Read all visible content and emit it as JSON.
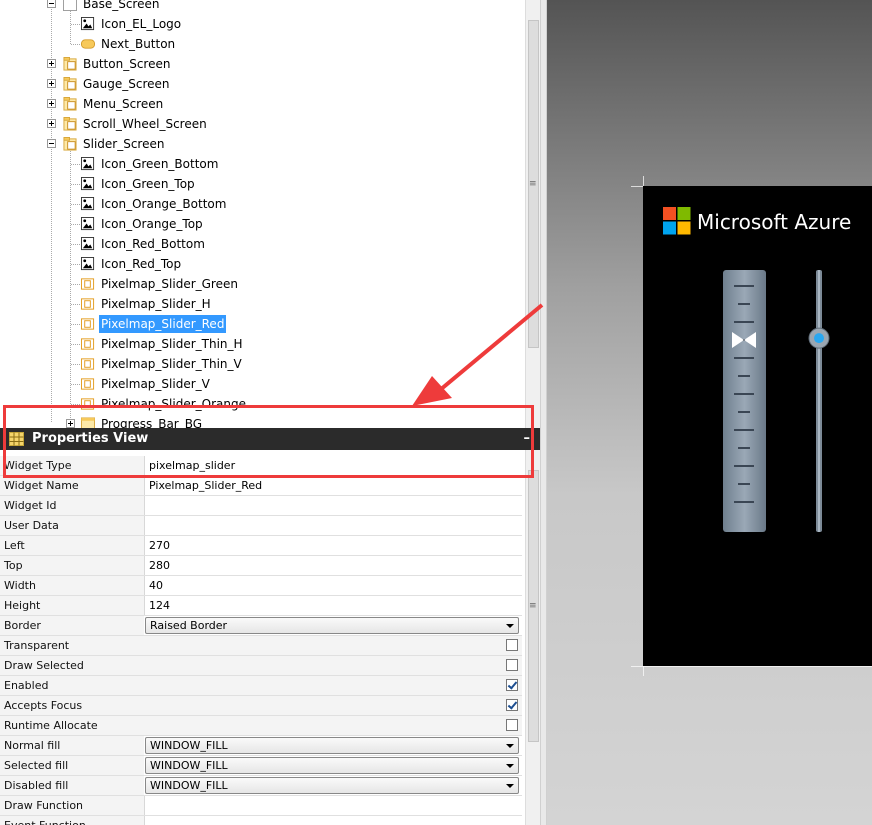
{
  "tree": {
    "items": [
      {
        "label": "Base_Screen",
        "icon": "screen-icon",
        "expander": "minus",
        "level": 0
      },
      {
        "label": "Icon_EL_Logo",
        "icon": "image-icon",
        "level": 1
      },
      {
        "label": "Next_Button",
        "icon": "button-icon",
        "level": 1
      },
      {
        "label": "Button_Screen",
        "icon": "folder-screen-icon",
        "expander": "plus",
        "level": 0
      },
      {
        "label": "Gauge_Screen",
        "icon": "folder-screen-icon",
        "expander": "plus",
        "level": 0
      },
      {
        "label": "Menu_Screen",
        "icon": "folder-screen-icon",
        "expander": "plus",
        "level": 0
      },
      {
        "label": "Scroll_Wheel_Screen",
        "icon": "folder-screen-icon",
        "expander": "plus",
        "level": 0
      },
      {
        "label": "Slider_Screen",
        "icon": "folder-screen-icon",
        "expander": "minus",
        "level": 0
      },
      {
        "label": "Icon_Green_Bottom",
        "icon": "image-icon",
        "level": 1
      },
      {
        "label": "Icon_Green_Top",
        "icon": "image-icon",
        "level": 1
      },
      {
        "label": "Icon_Orange_Bottom",
        "icon": "image-icon",
        "level": 1
      },
      {
        "label": "Icon_Orange_Top",
        "icon": "image-icon",
        "level": 1
      },
      {
        "label": "Icon_Red_Bottom",
        "icon": "image-icon",
        "level": 1
      },
      {
        "label": "Icon_Red_Top",
        "icon": "image-icon",
        "level": 1
      },
      {
        "label": "Pixelmap_Slider_Green",
        "icon": "slider-icon",
        "level": 1
      },
      {
        "label": "Pixelmap_Slider_H",
        "icon": "slider-icon",
        "level": 1
      },
      {
        "label": "Pixelmap_Slider_Red",
        "icon": "slider-icon",
        "level": 1,
        "selected": true
      },
      {
        "label": "Pixelmap_Slider_Thin_H",
        "icon": "slider-icon",
        "level": 1
      },
      {
        "label": "Pixelmap_Slider_Thin_V",
        "icon": "slider-icon",
        "level": 1
      },
      {
        "label": "Pixelmap_Slider_V",
        "icon": "slider-icon",
        "level": 1
      },
      {
        "label": "Pixelmap_Slider_Orange",
        "icon": "slider-icon",
        "level": 1
      },
      {
        "label": "Progress_Bar_BG",
        "icon": "window-icon",
        "expander": "plus",
        "level": 1
      }
    ]
  },
  "properties": {
    "title": "Properties View",
    "minimize": "–",
    "rows": [
      {
        "name": "Widget Type",
        "value": "pixelmap_slider",
        "kind": "text"
      },
      {
        "name": "Widget Name",
        "value": "Pixelmap_Slider_Red",
        "kind": "text"
      },
      {
        "name": "Widget Id",
        "value": "",
        "kind": "text"
      },
      {
        "name": "User Data",
        "value": "",
        "kind": "text"
      },
      {
        "name": "Left",
        "value": "270",
        "kind": "text"
      },
      {
        "name": "Top",
        "value": "280",
        "kind": "text"
      },
      {
        "name": "Width",
        "value": "40",
        "kind": "text"
      },
      {
        "name": "Height",
        "value": "124",
        "kind": "text"
      },
      {
        "name": "Border",
        "value": "Raised Border",
        "kind": "select"
      },
      {
        "name": "Transparent",
        "checked": false,
        "kind": "check"
      },
      {
        "name": "Draw Selected",
        "checked": false,
        "kind": "check"
      },
      {
        "name": "Enabled",
        "checked": true,
        "kind": "check"
      },
      {
        "name": "Accepts Focus",
        "checked": true,
        "kind": "check"
      },
      {
        "name": "Runtime Allocate",
        "checked": false,
        "kind": "check"
      },
      {
        "name": "Normal fill",
        "value": "WINDOW_FILL",
        "kind": "select"
      },
      {
        "name": "Selected fill",
        "value": "WINDOW_FILL",
        "kind": "select"
      },
      {
        "name": "Disabled fill",
        "value": "WINDOW_FILL",
        "kind": "select"
      },
      {
        "name": "Draw Function",
        "value": "",
        "kind": "text"
      },
      {
        "name": "Event Function",
        "value": "",
        "kind": "text"
      }
    ]
  },
  "preview": {
    "logo_text": "Microsoft Azure",
    "logo_colors": [
      "#f25022",
      "#7fba00",
      "#00a4ef",
      "#ffb900"
    ],
    "thin_slider_value": 0.26
  },
  "colors": {
    "selection": "#3399ff",
    "annotation": "#ee3b3b"
  }
}
